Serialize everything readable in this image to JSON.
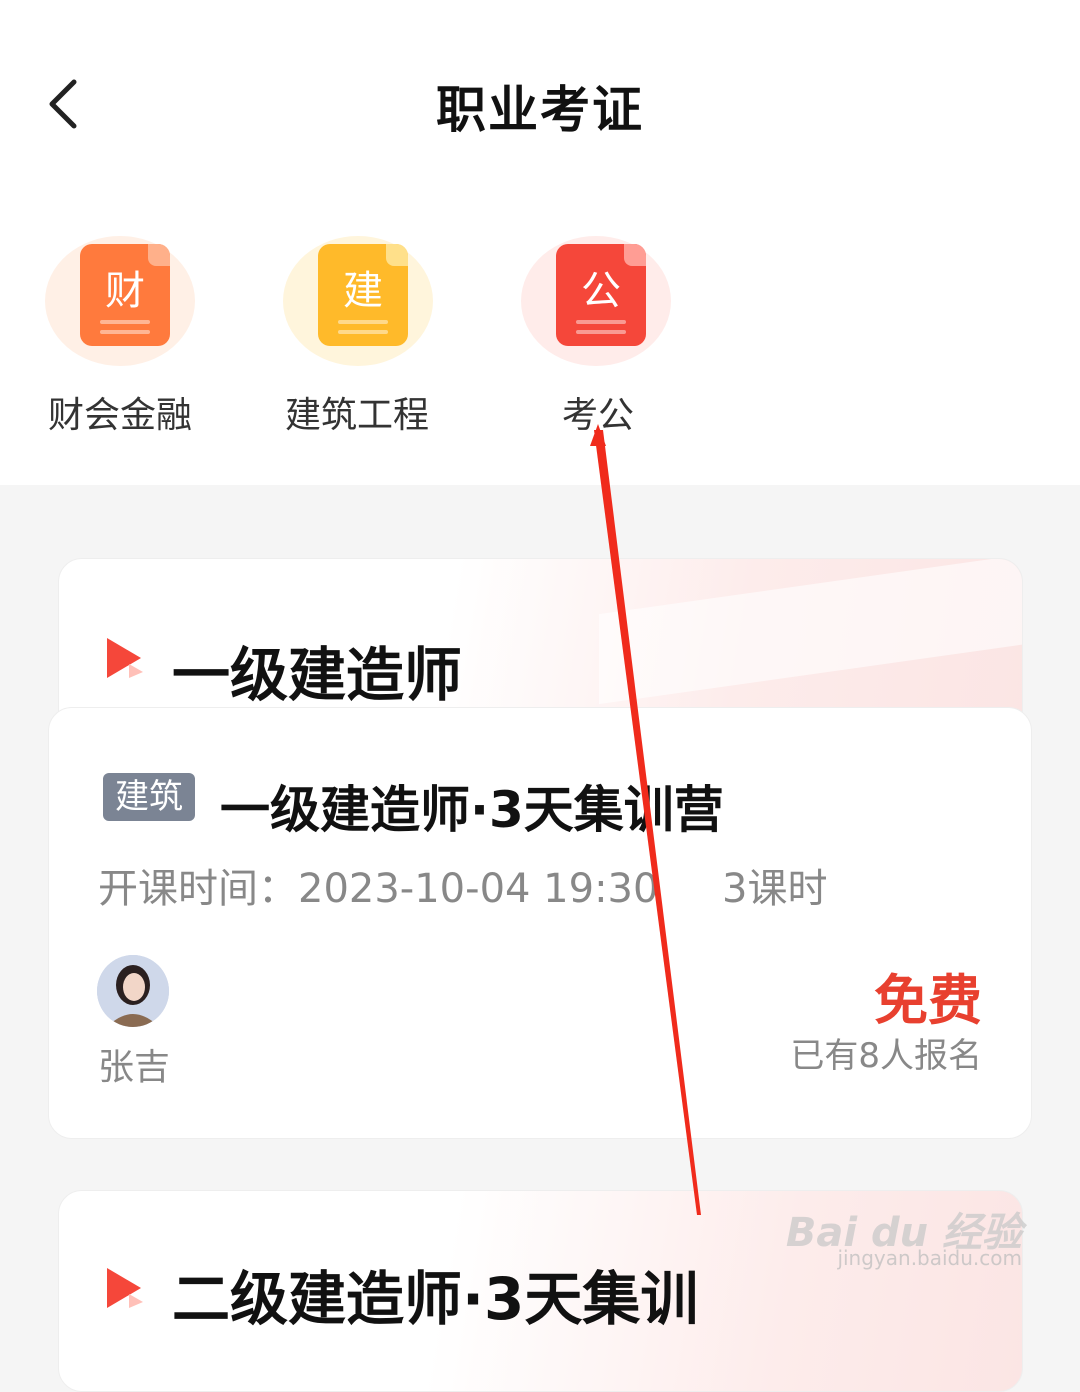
{
  "header": {
    "title": "职业考证"
  },
  "categories": [
    {
      "glyph": "财",
      "label": "财会金融",
      "icon": "finance-icon",
      "color": "#ff7a3d"
    },
    {
      "glyph": "建",
      "label": "建筑工程",
      "icon": "construction-icon",
      "color": "#ffba2a"
    },
    {
      "glyph": "公",
      "label": "考公",
      "icon": "civil-service-icon",
      "color": "#f5473a"
    }
  ],
  "section1": {
    "title": "一级建造师"
  },
  "course": {
    "tag": "建筑",
    "title": "一级建造师·3天集训营",
    "time_label": "开课时间：",
    "time": "2023-10-04 19:30",
    "hours": "3课时",
    "teacher": "张吉",
    "price": "免费",
    "signup": "已有8人报名"
  },
  "section2": {
    "title": "二级建造师·3天集训"
  },
  "watermark": {
    "brand": "Bai du 经验",
    "url": "jingyan.baidu.com"
  },
  "colors": {
    "accent": "#e8402f",
    "annotation_arrow": "#f02b1c"
  }
}
